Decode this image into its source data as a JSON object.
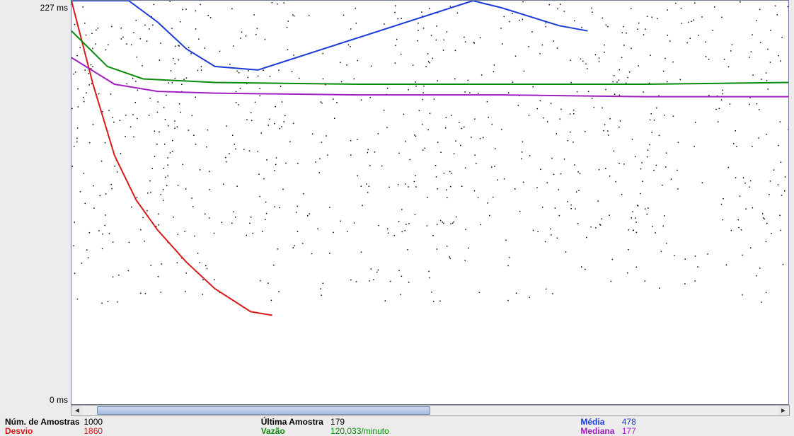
{
  "yaxis": {
    "top_label": "227 ms",
    "bottom_label": "0 ms"
  },
  "scrollbar": {
    "thumb_left_pct": 2,
    "thumb_width_pct": 48
  },
  "stats": {
    "row1": {
      "num_amostras": {
        "label": "Núm. de Amostras",
        "value": "1000"
      },
      "ultima_amostra": {
        "label": "Última Amostra",
        "value": "179"
      },
      "media": {
        "label": "Média",
        "value": "478"
      }
    },
    "row2": {
      "desvio": {
        "label": "Desvio",
        "value": "1860"
      },
      "vazao": {
        "label": "Vazão",
        "value": "120,033/minuto"
      },
      "mediana": {
        "label": "Mediana",
        "value": "177"
      }
    }
  },
  "chart_data": {
    "type": "line",
    "title": "",
    "xlabel": "",
    "ylabel": "ms",
    "ylim": [
      0,
      227
    ],
    "x_range": [
      0,
      1000
    ],
    "series": [
      {
        "name": "Amostras (scatter)",
        "color": "#000000",
        "style": "scatter",
        "note": "~1000 pontos dispersos entre y≈14 e y≈225"
      },
      {
        "name": "Média",
        "color": "#1a3bd8",
        "x": [
          0,
          40,
          80,
          120,
          160,
          200,
          260,
          560,
          600,
          640,
          680,
          720
        ],
        "y": [
          700,
          380,
          270,
          215,
          200,
          190,
          188,
          227,
          223,
          218,
          213,
          210
        ]
      },
      {
        "name": "Desvio",
        "color": "#d81a1a",
        "x": [
          0,
          30,
          60,
          90,
          120,
          160,
          200,
          250,
          280
        ],
        "y": [
          227,
          180,
          140,
          115,
          98,
          80,
          65,
          52,
          50
        ]
      },
      {
        "name": "Vazão",
        "color": "#0a8a0a",
        "x": [
          0,
          50,
          100,
          200,
          400,
          600,
          800,
          1000
        ],
        "y": [
          210,
          190,
          183,
          181,
          180,
          180,
          180,
          181
        ]
      },
      {
        "name": "Mediana",
        "color": "#a020c0",
        "x": [
          0,
          60,
          120,
          200,
          400,
          600,
          800,
          1000
        ],
        "y": [
          195,
          180,
          176,
          175,
          174,
          174,
          173,
          173
        ]
      }
    ]
  }
}
